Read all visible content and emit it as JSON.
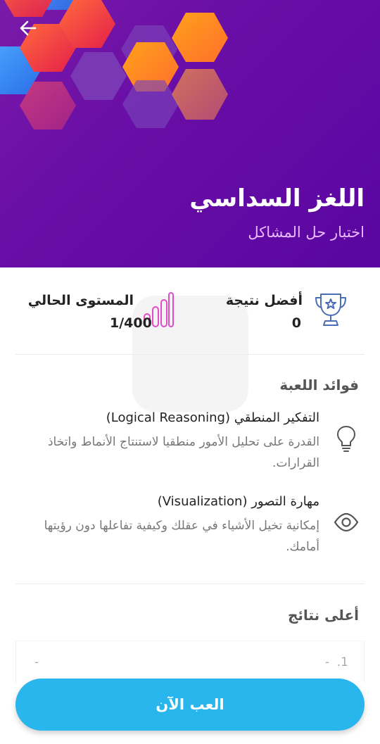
{
  "header": {
    "title": "اللغز السداسي",
    "subtitle": "اختبار حل المشاكل",
    "back_icon": "arrow-left-icon",
    "colors": {
      "background": "#6a0fa6",
      "subtitle": "#e8b9ff"
    }
  },
  "stats": {
    "best_score": {
      "label": "أفضل نتيجة",
      "value": "0",
      "icon": "trophy-icon"
    },
    "current_level": {
      "label": "المستوى الحالي",
      "value": "1/400",
      "icon": "signal-bars-icon"
    }
  },
  "benefits": {
    "title": "فوائد اللعبة",
    "items": [
      {
        "title": "التفكير المنطقي (Logical Reasoning)",
        "description": "القدرة على تحليل الأمور منطقيا لاستنتاج الأنماط واتخاذ القرارات.",
        "icon": "lightbulb-icon"
      },
      {
        "title": "مهارة التصور (Visualization)",
        "description": "إمكانية تخيل الأشياء في عقلك وكيفية تفاعلها دون رؤيتها أمامك.",
        "icon": "eye-icon"
      }
    ]
  },
  "top_results": {
    "title": "أعلى نتائج",
    "rows": [
      {
        "rank": "1.",
        "name": "-",
        "score": "-"
      }
    ]
  },
  "play_button": {
    "label": "العب الآن",
    "color": "#29b6ec"
  }
}
